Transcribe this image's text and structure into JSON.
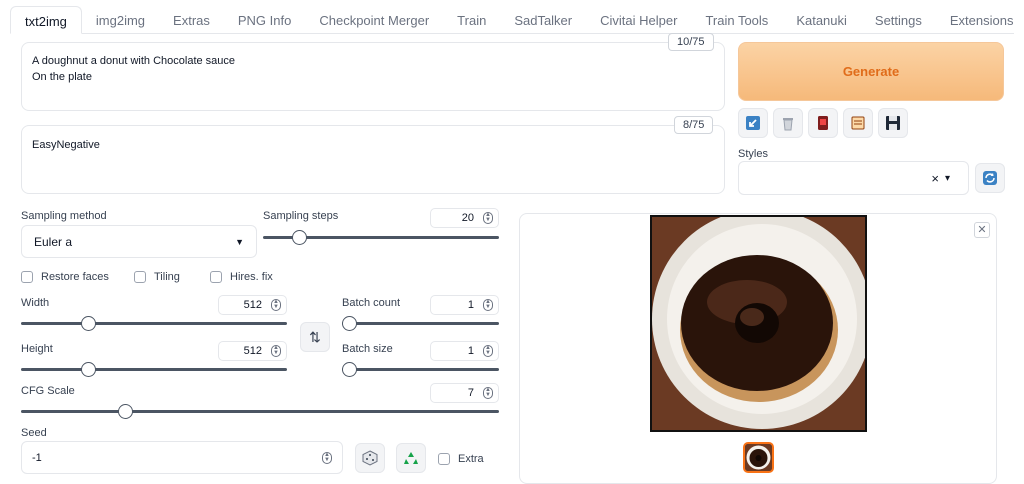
{
  "tabs": [
    "txt2img",
    "img2img",
    "Extras",
    "PNG Info",
    "Checkpoint Merger",
    "Train",
    "SadTalker",
    "Civitai Helper",
    "Train Tools",
    "Katanuki",
    "Settings",
    "Extensions"
  ],
  "prompt": {
    "text": "A doughnut a donut with Chocolate sauce\nOn the plate",
    "token_count": "10/75"
  },
  "negative_prompt": {
    "text": "EasyNegative",
    "token_count": "8/75"
  },
  "generate_label": "Generate",
  "styles": {
    "label": "Styles",
    "clear": "×",
    "caret": "▾"
  },
  "sampling": {
    "method_label": "Sampling method",
    "method_value": "Euler a",
    "steps_label": "Sampling steps",
    "steps_value": "20",
    "steps_fraction": 0.13
  },
  "checkboxes": {
    "restore_faces": "Restore faces",
    "tiling": "Tiling",
    "hires_fix": "Hires. fix"
  },
  "width": {
    "label": "Width",
    "value": "512",
    "fraction": 0.24
  },
  "height": {
    "label": "Height",
    "value": "512",
    "fraction": 0.24
  },
  "batch_count": {
    "label": "Batch count",
    "value": "1",
    "fraction": 0.0
  },
  "batch_size": {
    "label": "Batch size",
    "value": "1",
    "fraction": 0.0
  },
  "cfg_scale": {
    "label": "CFG Scale",
    "value": "7",
    "fraction": 0.21
  },
  "seed": {
    "label": "Seed",
    "value": "-1",
    "extra_label": "Extra"
  },
  "swap_icon": "⇅"
}
